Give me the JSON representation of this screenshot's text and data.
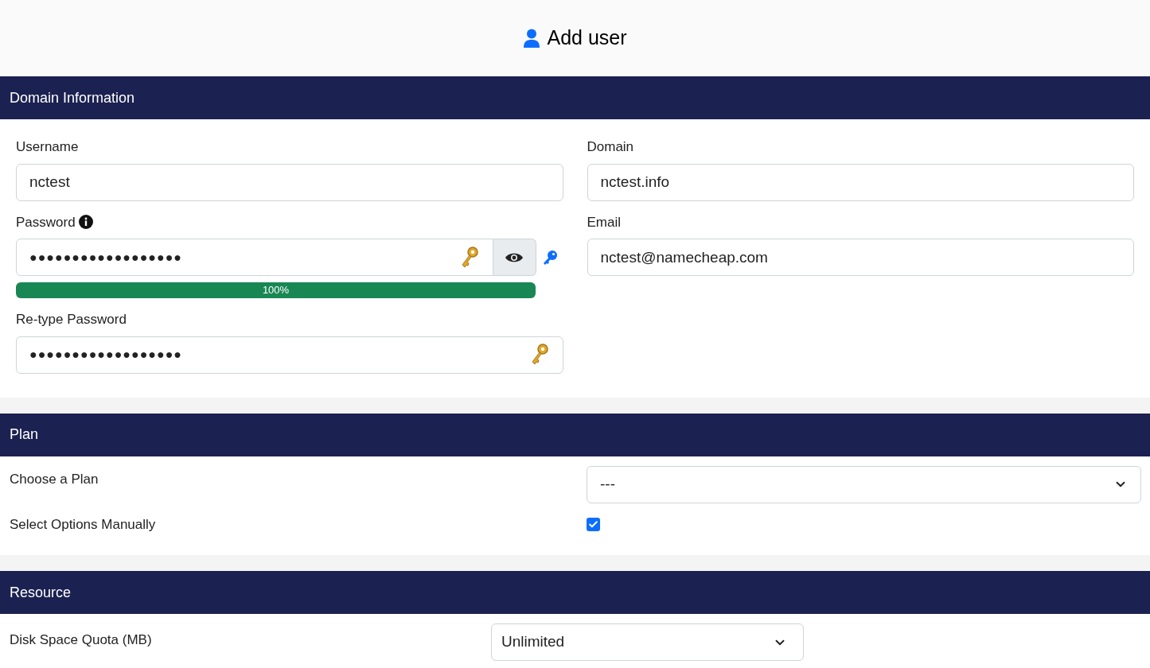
{
  "page_title": "Add user",
  "domain_section": {
    "title": "Domain Information",
    "username": {
      "label": "Username",
      "value": "nctest"
    },
    "domain": {
      "label": "Domain",
      "value": "nctest.info"
    },
    "password": {
      "label": "Password",
      "value": "●●●●●●●●●●●●●●●●●●",
      "strength": {
        "level": 1,
        "reading": "100%"
      }
    },
    "email": {
      "label": "Email",
      "value": "nctest@namecheap.com"
    },
    "retype_password": {
      "label": "Re-type Password",
      "value": "●●●●●●●●●●●●●●●●●●"
    }
  },
  "plan_section": {
    "title": "Plan",
    "choose_plan": {
      "label": "Choose a Plan",
      "value": "---"
    },
    "manual_options": {
      "label": "Select Options Manually",
      "checked": true
    }
  },
  "resource_section": {
    "title": "Resource",
    "disk_quota": {
      "label": "Disk Space Quota (MB)",
      "value": "Unlimited"
    }
  }
}
